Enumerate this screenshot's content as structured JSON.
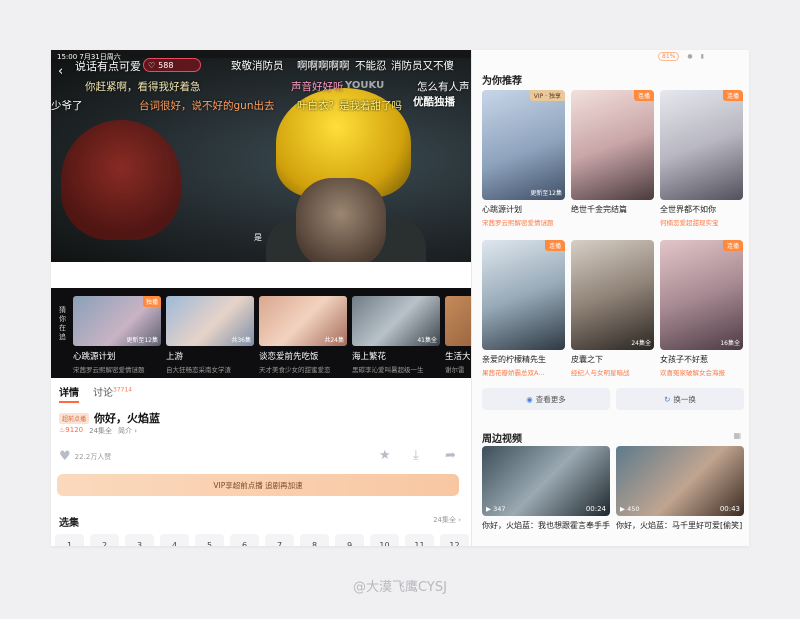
{
  "player": {
    "status_time": "15:00 7月31日周六",
    "heat_value": "588",
    "youku_logo": "YOUKU",
    "subtitle": "是",
    "barrage": [
      {
        "text": "说话有点可爱",
        "color": "#ffffff"
      },
      {
        "text": "致敬消防员",
        "color": "#ffffff"
      },
      {
        "text": "啊啊啊啊啊",
        "color": "#ffffff"
      },
      {
        "text": "不能忍",
        "color": "#ffffff"
      },
      {
        "text": "消防员又不傻",
        "color": "#ffffff"
      },
      {
        "text": "你赶紧啊，看得我好着急",
        "color": "#f0e6b0"
      },
      {
        "text": "声音好好听",
        "color": "#ff9ec4"
      },
      {
        "text": "怎么有人声",
        "color": "#ffffff"
      },
      {
        "text": "少爷了",
        "color": "#ffffff"
      },
      {
        "text": "台词很好，说不好的gun出去",
        "color": "#ff9f63"
      },
      {
        "text": "叶白衣？是我着甜了吗",
        "color": "#fff176"
      },
      {
        "text": "优酷独播",
        "color": "#ffffff"
      }
    ]
  },
  "strip": {
    "label": "猜你在追",
    "items": [
      {
        "title": "心跳源计划",
        "sub": "宋茜罗云熙解密爱情谜题",
        "badge": "独播",
        "count": "更新至12集"
      },
      {
        "title": "上游",
        "sub": "自大狂畅恋采南女学渣",
        "badge": "",
        "count": "共36集"
      },
      {
        "title": "谈恋爱前先吃饭",
        "sub": "天才美食少女的甜蜜爱恋",
        "badge": "",
        "count": "共24集"
      },
      {
        "title": "海上繁花",
        "sub": "黑碳李沁爱叫暑超级一生",
        "badge": "",
        "count": "41集全"
      },
      {
        "title": "生活大",
        "sub": "谢尔雷",
        "badge": "",
        "count": ""
      }
    ]
  },
  "detail": {
    "tab_detail": "详情",
    "tab_discuss": "讨论",
    "discuss_count": "37714",
    "badge": "超前点播",
    "title": "你好，火焰蓝",
    "heat": "9120",
    "episodes": "24集全",
    "intro_link": "简介 ›",
    "likes": "22.2万人赞",
    "vip_button": "VIP享超前点播 追剧再加速",
    "select_label": "选集",
    "select_more": "24集全 ›",
    "episode_numbers": [
      "1",
      "2",
      "3",
      "4",
      "5",
      "6",
      "7",
      "8",
      "9",
      "10",
      "11",
      "12"
    ]
  },
  "right": {
    "battery": "81%",
    "rec_title": "为你推荐",
    "cards": [
      {
        "name": "心跳源计划",
        "sub": "宋茜罗云熙解密爱情谜题",
        "badge": "VIP · 独享",
        "count": "更新至12集"
      },
      {
        "name": "绝世千金完结篇",
        "sub": "",
        "badge": "连播",
        "count": ""
      },
      {
        "name": "全世界都不如你",
        "sub": "何楠恋爱超甜现实宝",
        "badge": "连播",
        "count": ""
      },
      {
        "name": "亲爱的柠檬精先生",
        "sub": "果茜花瓣娇霸总双A...",
        "badge": "连播",
        "count": ""
      },
      {
        "name": "皮囊之下",
        "sub": "经纪人与女明星暗战",
        "badge": "",
        "count": "24集全"
      },
      {
        "name": "女孩子不好惹",
        "sub": "欢喜冤家破解女会海报",
        "badge": "连播",
        "count": "16集全"
      }
    ],
    "see_more": "查看更多",
    "refresh": "换一换",
    "near_title": "周边视频",
    "near_videos": [
      {
        "text": "你好，火焰蓝：我也想跟霍言奉手手",
        "views": "347",
        "time": "00:24"
      },
      {
        "text": "你好，火焰蓝：马千里好可爱[偷笑]",
        "views": "450",
        "time": "00:43"
      }
    ]
  },
  "watermark": "@大漠飞鹰CYSJ"
}
